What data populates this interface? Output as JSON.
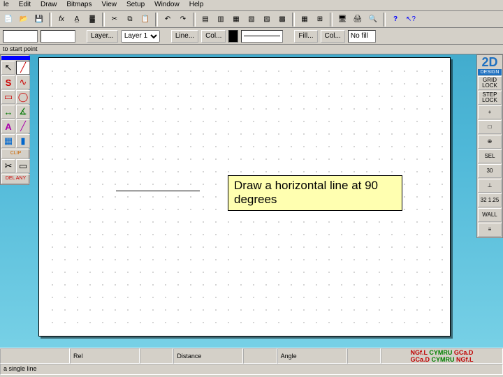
{
  "menu": [
    "le",
    "Edit",
    "Draw",
    "Bitmaps",
    "View",
    "Setup",
    "Window",
    "Help"
  ],
  "toolbar_icons": [
    "new",
    "open",
    "save",
    "sep",
    "fx",
    "text",
    "color",
    "sep",
    "cut",
    "copy",
    "paste",
    "sep",
    "undo",
    "redo",
    "sep",
    "align-l",
    "align-c",
    "align-r",
    "align-t",
    "align-m",
    "align-b",
    "sep",
    "grid",
    "snap",
    "sep",
    "monitor",
    "print",
    "printprev",
    "sep",
    "help",
    "whatsthis"
  ],
  "propbar": {
    "layer_btn": "Layer...",
    "layer_value": "Layer 1",
    "line_btn": "Line...",
    "col_btn": "Col...",
    "fill_btn": "Fill...",
    "fcol_btn": "Col...",
    "fill_value": "No fill"
  },
  "hint": "to start point",
  "left_tools": [
    {
      "name": "select",
      "icon": "↖"
    },
    {
      "name": "line",
      "icon": "╱",
      "sel": true
    },
    {
      "name": "shape-s",
      "icon": "S"
    },
    {
      "name": "shape-u",
      "icon": "∿"
    },
    {
      "name": "rect",
      "icon": "▭"
    },
    {
      "name": "circle",
      "icon": "◯"
    },
    {
      "name": "measure",
      "icon": "📏"
    },
    {
      "name": "angle",
      "icon": "∠"
    },
    {
      "name": "text",
      "icon": "A"
    },
    {
      "name": "path",
      "icon": "/"
    },
    {
      "name": "hatch",
      "icon": "▦"
    },
    {
      "name": "fill",
      "icon": "▮"
    },
    {
      "name": "clip",
      "icon": "✂"
    },
    {
      "name": "clip2",
      "icon": "□"
    }
  ],
  "left_labels": [
    "DEL ANY"
  ],
  "clip_label": "CLIP",
  "right_panel": {
    "logo": "2D",
    "logosub": "DESIGN",
    "buttons": [
      {
        "name": "grid",
        "label": "GRID LOCK"
      },
      {
        "name": "step",
        "label": "STEP LOCK"
      },
      {
        "name": "zoom-in",
        "label": "+"
      },
      {
        "name": "zoom-out",
        "label": "□"
      },
      {
        "name": "world",
        "label": "⊕"
      },
      {
        "name": "sel",
        "label": "SEL"
      },
      {
        "name": "rad",
        "label": "30"
      },
      {
        "name": "ortho",
        "label": "⊥"
      },
      {
        "name": "nums",
        "label": "32 1.25"
      },
      {
        "name": "wall",
        "label": "WALL"
      },
      {
        "name": "vert",
        "label": "≡"
      }
    ]
  },
  "callout_text": "Draw a horizontal line at 90 degrees",
  "status": {
    "rel": "Rel",
    "distance": "Distance",
    "angle": "Angle",
    "hint2": "a single line",
    "footer1_a": "NGf.L",
    "footer1_b": "CYMRU",
    "footer1_c": "GCa.D",
    "footer2_a": "GCa.D",
    "footer2_b": "CYMRU",
    "footer2_c": "NGf.L"
  }
}
